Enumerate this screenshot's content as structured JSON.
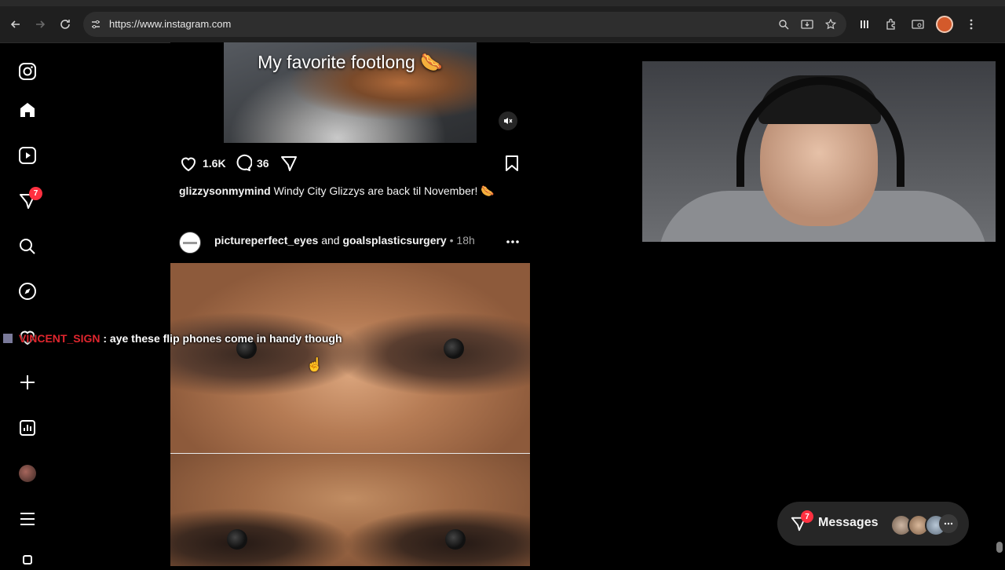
{
  "browser": {
    "url": "https://www.instagram.com"
  },
  "nav": {
    "notifications_badge": "7"
  },
  "video_post": {
    "overlay_text": "My favorite footlong 🌭",
    "likes": "1.6K",
    "comments": "36",
    "caption_user": "glizzysonmymind",
    "caption_text": "Windy City Glizzys are back til November! 🌭"
  },
  "photo_post": {
    "user1": "pictureperfect_eyes",
    "conjunction": "and",
    "user2": "goalsplasticsurgery",
    "separator": " • ",
    "time": "18h"
  },
  "chat_overlay": {
    "username": "VINCENT_SIGN",
    "separator": " : ",
    "message": "aye these flip phones come in handy though"
  },
  "messages": {
    "label": "Messages",
    "badge": "7"
  },
  "colors": {
    "badge_red": "#ff3040",
    "chat_username": "#e0262e",
    "background": "#000000"
  }
}
